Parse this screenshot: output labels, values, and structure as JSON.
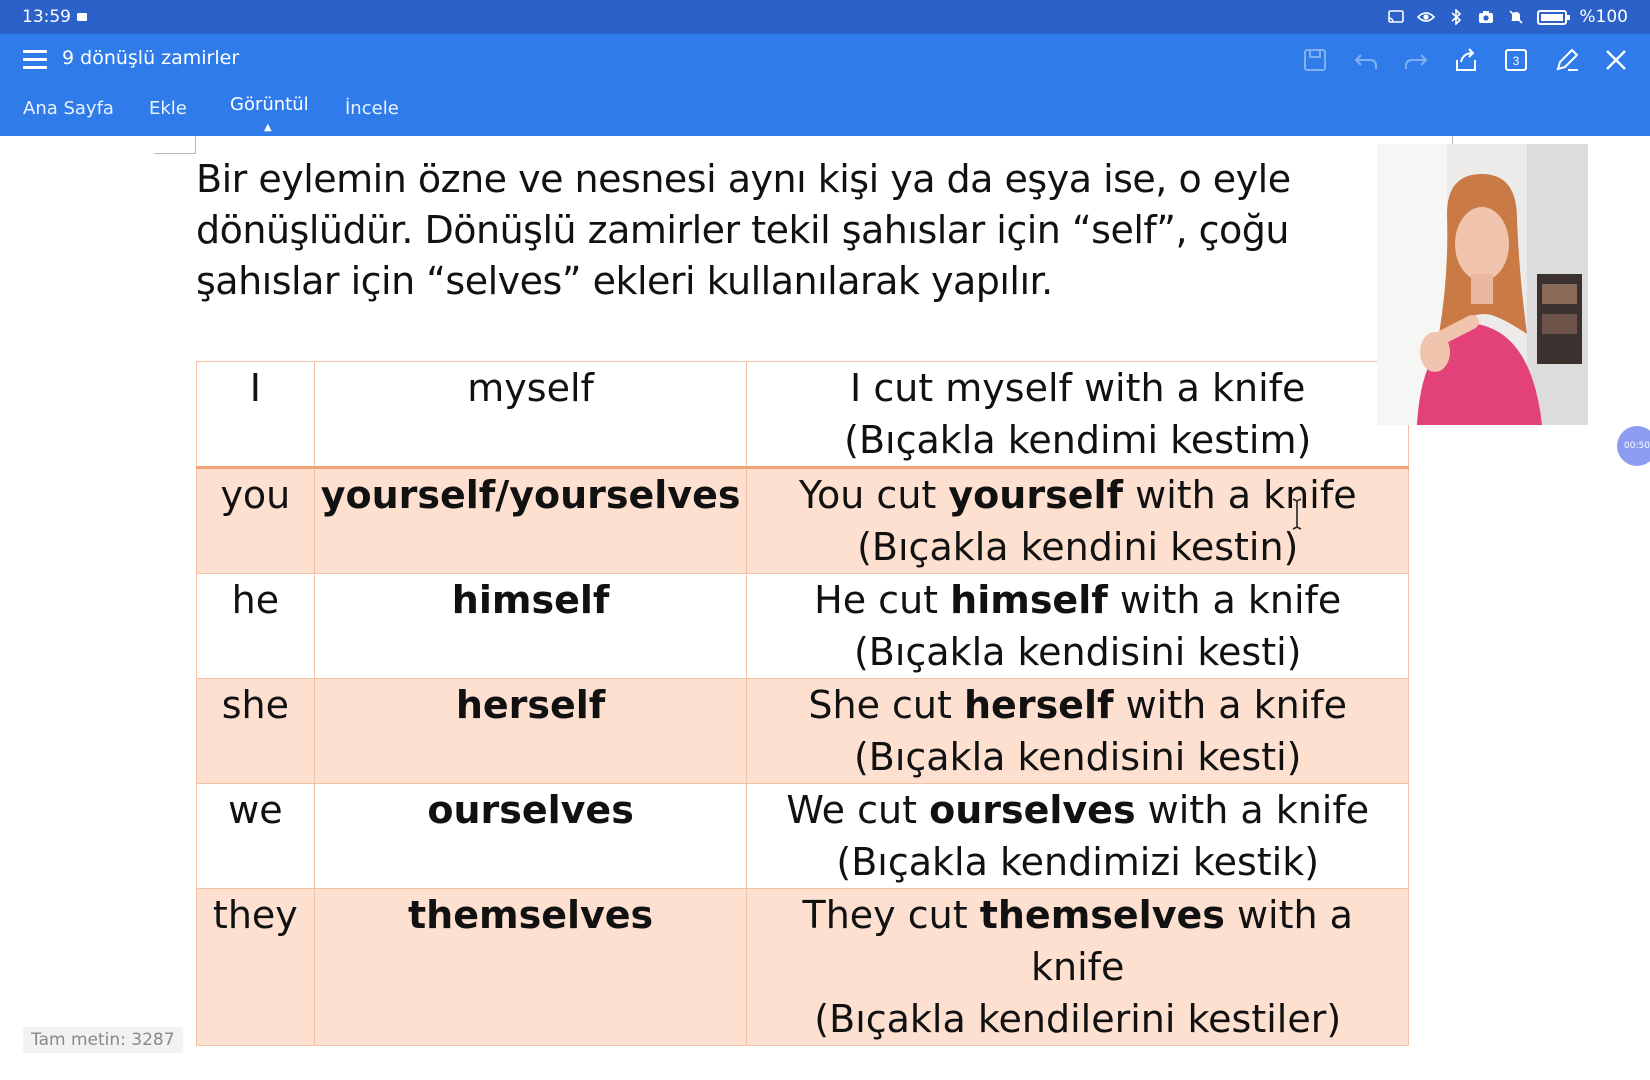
{
  "status_bar": {
    "time": "13:59",
    "battery": "%100",
    "icons": [
      "cast-icon",
      "eye-icon",
      "bluetooth-icon",
      "camera-icon",
      "mute-icon",
      "battery-icon"
    ]
  },
  "app": {
    "title": "9 dönüşlü zamirler",
    "tabs": [
      "Ana Sayfa",
      "Ekle",
      "Görüntül",
      "İncele"
    ],
    "active_tab": "Görüntül",
    "page_count_badge": "3",
    "toolbar_icons": [
      "save-icon",
      "undo-icon",
      "redo-icon",
      "share-icon",
      "pages-icon",
      "edit-icon",
      "close-icon"
    ],
    "colors": {
      "status_bar": "#2b61c9",
      "app_bar": "#2f7be9",
      "row_highlight": "#fde0d0",
      "table_border": "#f3c2a6"
    }
  },
  "document": {
    "intro_lines": [
      "Bir eylemin özne ve nesnesi aynı kişi ya da eşya ise, o eyle",
      "dönüşlüdür. Dönüşlü zamirler tekil şahıslar için “self”, çoğu",
      "şahıslar için “selves” ekleri kullanılarak yapılır."
    ],
    "rows": [
      {
        "subject": "I",
        "reflexive": "myself",
        "reflexive_bold": false,
        "ex_pre": "I cut myself with a knife",
        "ex_bold": "",
        "ex_post": "",
        "translation": "(Bıçakla kendimi kestim)"
      },
      {
        "subject": "you",
        "reflexive": "yourself/yourselves",
        "reflexive_bold": true,
        "ex_pre": "You cut ",
        "ex_bold": "yourself",
        "ex_post": " with a knife",
        "translation": "(Bıçakla kendini kestin)"
      },
      {
        "subject": "he",
        "reflexive": "himself",
        "reflexive_bold": true,
        "ex_pre": "He cut ",
        "ex_bold": "himself",
        "ex_post": " with a knife",
        "translation": "(Bıçakla kendisini kesti)"
      },
      {
        "subject": "she",
        "reflexive": "herself",
        "reflexive_bold": true,
        "ex_pre": "She cut ",
        "ex_bold": "herself",
        "ex_post": " with a knife",
        "translation": "(Bıçakla kendisini kesti)"
      },
      {
        "subject": "we",
        "reflexive": "ourselves",
        "reflexive_bold": true,
        "ex_pre": "We cut ",
        "ex_bold": "ourselves",
        "ex_post": " with a knife",
        "translation": "(Bıçakla kendimizi kestik)"
      },
      {
        "subject": "they",
        "reflexive": "themselves",
        "reflexive_bold": true,
        "ex_pre": "They cut ",
        "ex_bold": "themselves",
        "ex_post": " with a knife",
        "translation": "(Bıçakla kendilerini kestiler)"
      }
    ],
    "word_count_label": "Tam metin: 3287",
    "timer": "00:50"
  }
}
